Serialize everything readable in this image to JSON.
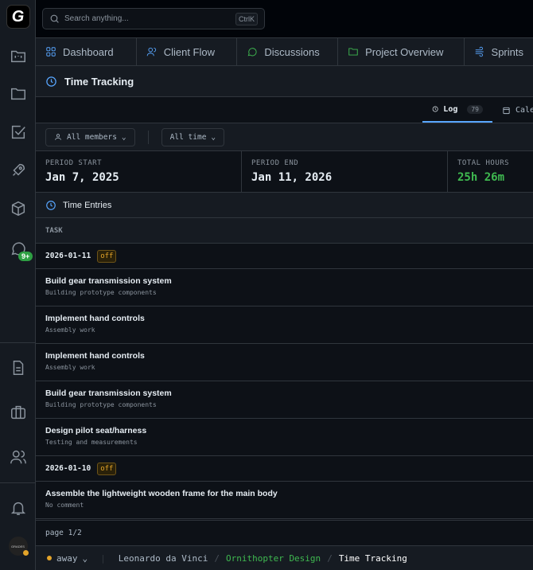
{
  "sidebar": {
    "logo": "G",
    "badge": "9+",
    "avatar_text": "GRADES"
  },
  "search": {
    "placeholder": "Search anything...",
    "shortcut": "CtrlK"
  },
  "nav_tabs": [
    {
      "label": "Dashboard",
      "icon": "grid-icon",
      "color": "#58a6ff"
    },
    {
      "label": "Client Flow",
      "icon": "users-icon",
      "color": "#58a6ff"
    },
    {
      "label": "Discussions",
      "icon": "chat-icon",
      "color": "#3fb950"
    },
    {
      "label": "Project Overview",
      "icon": "folder-icon",
      "color": "#3fb950"
    },
    {
      "label": "Sprints",
      "icon": "wind-icon",
      "color": "#58a6ff"
    }
  ],
  "page": {
    "title": "Time Tracking"
  },
  "view_tabs": {
    "log_label": "Log",
    "log_count": "79",
    "calendar_label": "Calendar"
  },
  "filters": {
    "members": "All members",
    "time": "All time"
  },
  "stats": [
    {
      "label": "PERIOD START",
      "value": "Jan 7, 2025"
    },
    {
      "label": "PERIOD END",
      "value": "Jan 11, 2026"
    },
    {
      "label": "TOTAL HOURS",
      "value": "25h 26m"
    }
  ],
  "entries_title": "Time Entries",
  "task_header": "TASK",
  "groups": [
    {
      "date": "2026-01-11",
      "tag": "off",
      "entries": [
        {
          "title": "Build gear transmission system",
          "comment": "Building prototype components"
        },
        {
          "title": "Implement hand controls",
          "comment": "Assembly work"
        },
        {
          "title": "Implement hand controls",
          "comment": "Assembly work"
        },
        {
          "title": "Build gear transmission system",
          "comment": "Building prototype components"
        },
        {
          "title": "Design pilot seat/harness",
          "comment": "Testing and measurements"
        }
      ]
    },
    {
      "date": "2026-01-10",
      "tag": "off",
      "entries": [
        {
          "title": "Assemble the lightweight wooden frame for the main body",
          "comment": "No comment"
        }
      ]
    }
  ],
  "pager": "page 1/2",
  "status": {
    "presence": "away",
    "breadcrumb": [
      "Leonardo da Vinci",
      "Ornithopter Design",
      "Time Tracking"
    ]
  },
  "colors": {
    "accent": "#58a6ff",
    "green": "#3fb950",
    "warn": "#e3a42a"
  }
}
